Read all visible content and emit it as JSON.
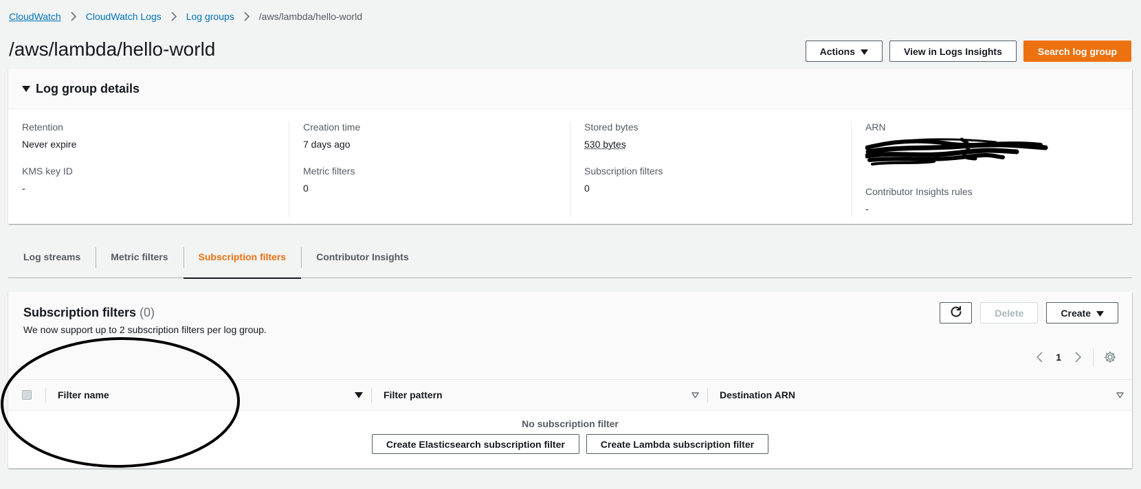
{
  "breadcrumb": {
    "items": [
      "CloudWatch",
      "CloudWatch Logs",
      "Log groups"
    ],
    "current": "/aws/lambda/hello-world"
  },
  "page": {
    "title": "/aws/lambda/hello-world"
  },
  "header_actions": {
    "actions": "Actions",
    "view_insights": "View in Logs Insights",
    "search": "Search log group"
  },
  "details": {
    "title": "Log group details",
    "retention": {
      "label": "Retention",
      "value": "Never expire"
    },
    "kms": {
      "label": "KMS key ID",
      "value": "-"
    },
    "creation": {
      "label": "Creation time",
      "value": "7 days ago"
    },
    "metric_filters": {
      "label": "Metric filters",
      "value": "0"
    },
    "stored_bytes": {
      "label": "Stored bytes",
      "value": "530 bytes"
    },
    "subscription_filters": {
      "label": "Subscription filters",
      "value": "0"
    },
    "arn": {
      "label": "ARN"
    },
    "contributor": {
      "label": "Contributor Insights rules",
      "value": "-"
    }
  },
  "tabs": [
    "Log streams",
    "Metric filters",
    "Subscription filters",
    "Contributor Insights"
  ],
  "panel": {
    "title": "Subscription filters",
    "count": "(0)",
    "description": "We now support up to 2 subscription filters per log group.",
    "delete": "Delete",
    "create": "Create"
  },
  "pagination": {
    "page": "1"
  },
  "table": {
    "columns": [
      "Filter name",
      "Filter pattern",
      "Destination ARN"
    ],
    "empty_title": "No subscription filter",
    "create_es": "Create Elasticsearch subscription filter",
    "create_lambda": "Create Lambda subscription filter"
  },
  "colors": {
    "link": "#0073bb",
    "accent": "#ec7211",
    "text": "#16191f",
    "background": "#f2f3f3"
  }
}
